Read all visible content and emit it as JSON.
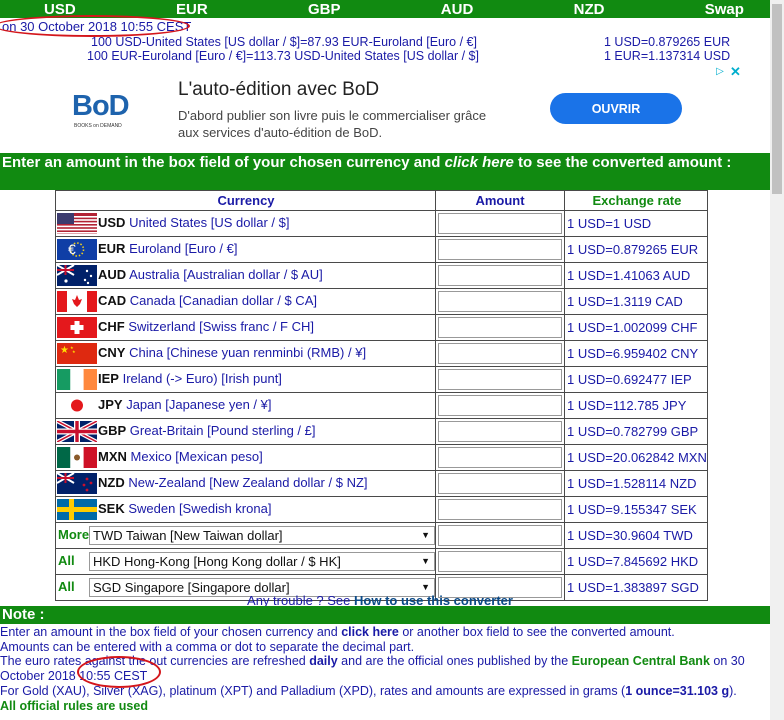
{
  "topnav": [
    "USD",
    "EUR",
    "GBP",
    "AUD",
    "NZD",
    "Swap"
  ],
  "date_line": "on 30 October 2018 10:55 CEST",
  "rate_lines": [
    {
      "left": "100 USD-United States [US dollar / $]=87.93 EUR-Euroland [Euro / €]",
      "right": "1 USD=0.879265 EUR"
    },
    {
      "left": "100 EUR-Euroland [Euro / €]=113.73 USD-United States [US dollar / $]",
      "right": "1 EUR=1.137314 USD"
    }
  ],
  "ad": {
    "logo": "BoD",
    "logo_sub": "BOOKS on DEMAND",
    "title": "L'auto-édition avec BoD",
    "desc": "D'abord publier son livre puis le commercialiser grâce aux services d'auto-édition de BoD.",
    "button": "OUVRIR"
  },
  "banner": {
    "text1": "Enter an amount in the box field of your chosen currency and ",
    "link": "click here",
    "text2": " to see the converted amount :"
  },
  "table": {
    "headers": [
      "Currency",
      "Amount",
      "Exchange rate"
    ],
    "rows": [
      {
        "code": "USD",
        "name": "United States [US dollar / $]",
        "rate": "1 USD=1 USD",
        "flag": "us-flag"
      },
      {
        "code": "EUR",
        "name": "Euroland [Euro / €]",
        "rate": "1 USD=0.879265 EUR",
        "flag": "eu-flag"
      },
      {
        "code": "AUD",
        "name": "Australia [Australian dollar / $ AU]",
        "rate": "1 USD=1.41063 AUD",
        "flag": "au-flag"
      },
      {
        "code": "CAD",
        "name": "Canada [Canadian dollar / $ CA]",
        "rate": "1 USD=1.3119 CAD",
        "flag": "ca-flag"
      },
      {
        "code": "CHF",
        "name": "Switzerland [Swiss franc / F CH]",
        "rate": "1 USD=1.002099 CHF",
        "flag": "ch-flag"
      },
      {
        "code": "CNY",
        "name": "China [Chinese yuan renminbi (RMB) / ¥]",
        "rate": "1 USD=6.959402 CNY",
        "flag": "cn-flag"
      },
      {
        "code": "IEP",
        "name": "Ireland (-> Euro) [Irish punt]",
        "rate": "1 USD=0.692477 IEP",
        "flag": "ie-flag"
      },
      {
        "code": "JPY",
        "name": "Japan [Japanese yen / ¥]",
        "rate": "1 USD=112.785 JPY",
        "flag": "jp-flag"
      },
      {
        "code": "GBP",
        "name": "Great-Britain [Pound sterling / £]",
        "rate": "1 USD=0.782799 GBP",
        "flag": "gb-flag"
      },
      {
        "code": "MXN",
        "name": "Mexico [Mexican peso]",
        "rate": "1 USD=20.062842 MXN",
        "flag": "mx-flag"
      },
      {
        "code": "NZD",
        "name": "New-Zealand [New Zealand dollar / $ NZ]",
        "rate": "1 USD=1.528114 NZD",
        "flag": "nz-flag"
      },
      {
        "code": "SEK",
        "name": "Sweden [Swedish krona]",
        "rate": "1 USD=9.155347 SEK",
        "flag": "se-flag"
      }
    ],
    "select_rows": [
      {
        "label": "More",
        "value": "TWD Taiwan [New Taiwan dollar]",
        "rate": "1 USD=30.9604 TWD"
      },
      {
        "label": "All",
        "value": "HKD Hong-Kong [Hong Kong dollar / $ HK]",
        "rate": "1 USD=7.845692 HKD"
      },
      {
        "label": "All",
        "value": "SGD Singapore [Singapore dollar]",
        "rate": "1 USD=1.383897 SGD"
      }
    ]
  },
  "trouble": {
    "text": "Any trouble ? See ",
    "link": "How to use this converter"
  },
  "note": {
    "heading": "Note :",
    "l1a": "Enter an amount in the box field of your chosen currency and ",
    "l1b": "click here",
    "l1c": " or another box field to see the converted amount.",
    "l2": "Amounts can be entered with a comma or dot to separate the decimal part.",
    "l3a": "The euro rates against the out currencies are refreshed ",
    "l3b": "daily",
    "l3c": " and are the official ones published by the ",
    "l3d": "European Central Bank",
    "l3e": " on 30 October 2018 10:55 CEST",
    "l4a": "For Gold (XAU), Silver (XAG), platinum (XPT) and Palladium (XPD), rates and amounts are expressed in grams (",
    "l4b": "1 ounce=31.103 g",
    "l4c": ").",
    "l5": "All official rules are used"
  }
}
